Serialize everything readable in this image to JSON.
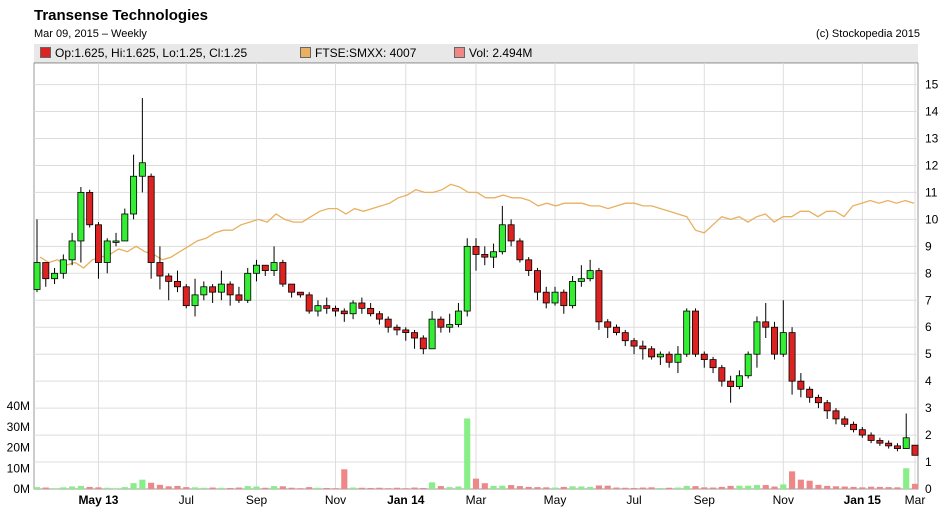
{
  "header": {
    "title": "Transense Technologies",
    "subtitle": "Mar 09, 2015 – Weekly",
    "copyright": "(c) Stockopedia 2015"
  },
  "legend": {
    "ohlc": "Op:1.625, Hi:1.625, Lo:1.25, Cl:1.25",
    "index": "FTSE:SMXX: 4007",
    "volume": "Vol: 2.494M"
  },
  "colors": {
    "up": "#33ee33",
    "down": "#dd2222",
    "index_line": "#e8b060",
    "vol_up": "#88ee88",
    "vol_down": "#ee8888",
    "grid": "#dddddd"
  },
  "chart_data": {
    "type": "candlestick",
    "price_axis": {
      "ticks": [
        1,
        2,
        3,
        4,
        5,
        6,
        7,
        8,
        9,
        10,
        11,
        12,
        13,
        14,
        15
      ],
      "range": [
        0,
        15.8
      ],
      "position": "right"
    },
    "volume_axis": {
      "ticks": [
        "0M",
        "10M",
        "20M",
        "30M",
        "40M"
      ],
      "range": [
        0,
        40
      ],
      "position": "left"
    },
    "x_ticks": [
      "May 13",
      "Jul",
      "Sep",
      "Nov",
      "Jan 14",
      "Mar",
      "May",
      "Jul",
      "Sep",
      "Nov",
      "Jan 15",
      "Mar"
    ],
    "x_ticks_bold": [
      "May 13",
      "Jan 14",
      "Jan 15"
    ],
    "candles": [
      [
        7.4,
        8.4,
        10.0,
        7.3,
        0.9
      ],
      [
        8.4,
        7.8,
        8.4,
        7.5,
        0.7
      ],
      [
        7.8,
        8.0,
        8.2,
        7.6,
        0.4
      ],
      [
        8.0,
        8.5,
        8.7,
        7.8,
        0.8
      ],
      [
        8.5,
        9.2,
        9.5,
        8.3,
        1.2
      ],
      [
        9.2,
        11.0,
        11.2,
        8.4,
        1.5
      ],
      [
        11.0,
        9.8,
        11.1,
        9.7,
        1.0
      ],
      [
        9.8,
        8.4,
        9.9,
        7.8,
        0.8
      ],
      [
        8.4,
        9.2,
        9.3,
        8.0,
        0.6
      ],
      [
        9.2,
        9.2,
        9.5,
        9.0,
        0.4
      ],
      [
        9.2,
        10.2,
        10.4,
        9.2,
        0.9
      ],
      [
        10.2,
        11.6,
        12.4,
        10.0,
        2.8
      ],
      [
        11.6,
        12.1,
        14.5,
        11.0,
        4.5
      ],
      [
        11.6,
        8.4,
        11.7,
        7.8,
        3.0
      ],
      [
        8.4,
        7.9,
        9.0,
        7.4,
        2.0
      ],
      [
        7.9,
        7.7,
        8.0,
        7.0,
        1.3
      ],
      [
        7.7,
        7.5,
        8.1,
        7.3,
        1.5
      ],
      [
        7.5,
        6.8,
        7.6,
        6.7,
        0.9
      ],
      [
        6.8,
        7.2,
        7.8,
        6.4,
        0.8
      ],
      [
        7.2,
        7.5,
        7.7,
        7.0,
        0.6
      ],
      [
        7.5,
        7.3,
        7.6,
        6.9,
        0.7
      ],
      [
        7.3,
        7.6,
        8.1,
        7.0,
        0.6
      ],
      [
        7.6,
        7.2,
        7.7,
        6.8,
        0.5
      ],
      [
        7.2,
        7.0,
        7.5,
        6.9,
        0.7
      ],
      [
        7.0,
        8.0,
        8.2,
        6.9,
        1.4
      ],
      [
        8.0,
        8.3,
        8.5,
        7.7,
        1.2
      ],
      [
        8.3,
        8.1,
        8.3,
        7.9,
        0.6
      ],
      [
        8.1,
        8.4,
        9.0,
        7.9,
        1.4
      ],
      [
        8.4,
        7.6,
        8.5,
        7.5,
        1.3
      ],
      [
        7.6,
        7.3,
        7.6,
        7.1,
        0.6
      ],
      [
        7.3,
        7.2,
        7.3,
        7.1,
        0.4
      ],
      [
        7.2,
        6.6,
        7.3,
        6.5,
        0.9
      ],
      [
        6.6,
        6.8,
        7.0,
        6.4,
        0.6
      ],
      [
        6.8,
        6.7,
        7.1,
        6.5,
        0.5
      ],
      [
        6.7,
        6.6,
        6.8,
        6.4,
        0.4
      ],
      [
        6.6,
        6.5,
        6.7,
        6.2,
        9.5
      ],
      [
        6.5,
        6.9,
        7.0,
        6.3,
        0.7
      ],
      [
        6.9,
        6.7,
        7.1,
        6.5,
        0.6
      ],
      [
        6.7,
        6.5,
        6.9,
        6.4,
        0.5
      ],
      [
        6.5,
        6.3,
        6.6,
        6.1,
        0.6
      ],
      [
        6.3,
        6.0,
        6.4,
        5.8,
        0.4
      ],
      [
        6.0,
        5.9,
        6.1,
        5.7,
        0.6
      ],
      [
        5.9,
        5.8,
        6.0,
        5.5,
        0.4
      ],
      [
        5.8,
        5.6,
        5.9,
        5.2,
        0.7
      ],
      [
        5.6,
        5.2,
        5.7,
        5.0,
        0.5
      ],
      [
        5.2,
        6.3,
        6.6,
        5.2,
        3.2
      ],
      [
        6.3,
        6.0,
        6.4,
        5.8,
        1.4
      ],
      [
        6.0,
        6.1,
        6.5,
        5.8,
        0.9
      ],
      [
        6.1,
        6.6,
        6.9,
        6.0,
        1.2
      ],
      [
        6.6,
        9.0,
        9.3,
        6.4,
        34.0
      ],
      [
        9.0,
        8.7,
        9.3,
        8.1,
        5.0
      ],
      [
        8.7,
        8.6,
        9.0,
        8.3,
        2.8
      ],
      [
        8.6,
        8.8,
        9.1,
        8.2,
        1.5
      ],
      [
        8.8,
        9.8,
        10.5,
        8.7,
        1.6
      ],
      [
        9.8,
        9.2,
        10.0,
        9.0,
        1.9
      ],
      [
        9.2,
        8.5,
        9.3,
        8.4,
        1.4
      ],
      [
        8.5,
        8.1,
        8.6,
        7.9,
        1.0
      ],
      [
        8.1,
        7.3,
        8.2,
        7.0,
        0.9
      ],
      [
        7.3,
        6.9,
        7.5,
        6.7,
        0.8
      ],
      [
        6.9,
        7.3,
        7.5,
        6.8,
        0.7
      ],
      [
        7.3,
        6.8,
        7.4,
        6.5,
        1.0
      ],
      [
        6.8,
        7.7,
        7.9,
        6.7,
        1.3
      ],
      [
        7.7,
        7.8,
        8.3,
        7.5,
        1.2
      ],
      [
        7.8,
        8.1,
        8.5,
        7.7,
        1.0
      ],
      [
        8.1,
        6.2,
        8.2,
        5.9,
        1.7
      ],
      [
        6.2,
        6.0,
        6.3,
        5.6,
        1.6
      ],
      [
        6.0,
        5.8,
        6.1,
        5.7,
        0.7
      ],
      [
        5.8,
        5.5,
        5.9,
        5.3,
        0.6
      ],
      [
        5.5,
        5.3,
        5.6,
        5.0,
        0.5
      ],
      [
        5.3,
        5.2,
        5.5,
        4.8,
        0.7
      ],
      [
        5.2,
        4.9,
        5.3,
        4.8,
        0.8
      ],
      [
        4.9,
        5.0,
        5.1,
        4.6,
        0.5
      ],
      [
        5.0,
        4.7,
        5.1,
        4.5,
        0.6
      ],
      [
        4.7,
        5.0,
        5.3,
        4.3,
        0.7
      ],
      [
        5.0,
        6.6,
        6.7,
        4.9,
        1.5
      ],
      [
        6.6,
        5.0,
        6.7,
        4.9,
        1.4
      ],
      [
        5.0,
        4.8,
        5.1,
        4.5,
        0.8
      ],
      [
        4.8,
        4.5,
        4.9,
        4.3,
        0.7
      ],
      [
        4.5,
        4.0,
        4.6,
        3.8,
        1.0
      ],
      [
        4.0,
        3.8,
        4.2,
        3.2,
        1.5
      ],
      [
        3.8,
        4.2,
        4.4,
        3.7,
        1.6
      ],
      [
        4.2,
        5.0,
        5.1,
        4.1,
        1.6
      ],
      [
        5.0,
        6.2,
        6.4,
        4.5,
        1.9
      ],
      [
        6.2,
        6.0,
        6.9,
        5.6,
        1.9
      ],
      [
        6.0,
        5.0,
        6.2,
        4.8,
        1.2
      ],
      [
        5.0,
        5.8,
        7.0,
        4.9,
        2.2
      ],
      [
        5.8,
        4.0,
        6.0,
        3.5,
        8.5
      ],
      [
        4.0,
        3.7,
        4.3,
        3.4,
        4.5
      ],
      [
        3.7,
        3.4,
        3.8,
        3.2,
        4.0
      ],
      [
        3.4,
        3.2,
        3.5,
        3.0,
        2.0
      ],
      [
        3.2,
        2.9,
        3.3,
        2.6,
        1.5
      ],
      [
        2.9,
        2.6,
        3.0,
        2.4,
        1.3
      ],
      [
        2.6,
        2.4,
        2.7,
        2.3,
        1.2
      ],
      [
        2.4,
        2.2,
        2.5,
        2.1,
        1.0
      ],
      [
        2.2,
        2.0,
        2.3,
        1.9,
        0.8
      ],
      [
        2.0,
        1.8,
        2.1,
        1.7,
        1.1
      ],
      [
        1.8,
        1.7,
        1.9,
        1.6,
        1.0
      ],
      [
        1.7,
        1.6,
        1.8,
        1.5,
        0.9
      ],
      [
        1.6,
        1.5,
        1.7,
        1.4,
        0.8
      ],
      [
        1.5,
        1.9,
        2.8,
        1.5,
        10.0
      ],
      [
        1.625,
        1.25,
        1.625,
        1.25,
        2.494
      ]
    ],
    "candle_fields": [
      "open",
      "close",
      "high",
      "low",
      "volume_millions"
    ],
    "index_series": {
      "name": "FTSE:SMXX",
      "scaled_values": [
        8.6,
        8.4,
        8.5,
        8.3,
        8.4,
        8.2,
        8.5,
        8.6,
        8.7,
        8.9,
        8.8,
        9.0,
        8.8,
        8.7,
        8.5,
        8.6,
        8.8,
        9.0,
        9.2,
        9.3,
        9.5,
        9.6,
        9.6,
        9.8,
        9.9,
        10.0,
        9.9,
        10.2,
        10.0,
        9.9,
        9.9,
        10.1,
        10.3,
        10.4,
        10.4,
        10.2,
        10.4,
        10.3,
        10.4,
        10.5,
        10.6,
        10.8,
        10.9,
        11.1,
        11.0,
        11.0,
        11.1,
        11.3,
        11.2,
        11.0,
        11.0,
        10.8,
        10.8,
        10.9,
        10.8,
        10.8,
        10.7,
        10.5,
        10.6,
        10.5,
        10.6,
        10.6,
        10.6,
        10.5,
        10.5,
        10.4,
        10.5,
        10.6,
        10.6,
        10.5,
        10.5,
        10.4,
        10.3,
        10.2,
        10.1,
        9.6,
        9.5,
        9.8,
        10.1,
        10.0,
        10.1,
        9.9,
        10.1,
        10.2,
        9.9,
        10.1,
        10.1,
        10.3,
        10.3,
        10.1,
        10.3,
        10.3,
        10.1,
        10.5,
        10.6,
        10.7,
        10.6,
        10.7,
        10.6,
        10.7,
        10.6
      ]
    }
  }
}
